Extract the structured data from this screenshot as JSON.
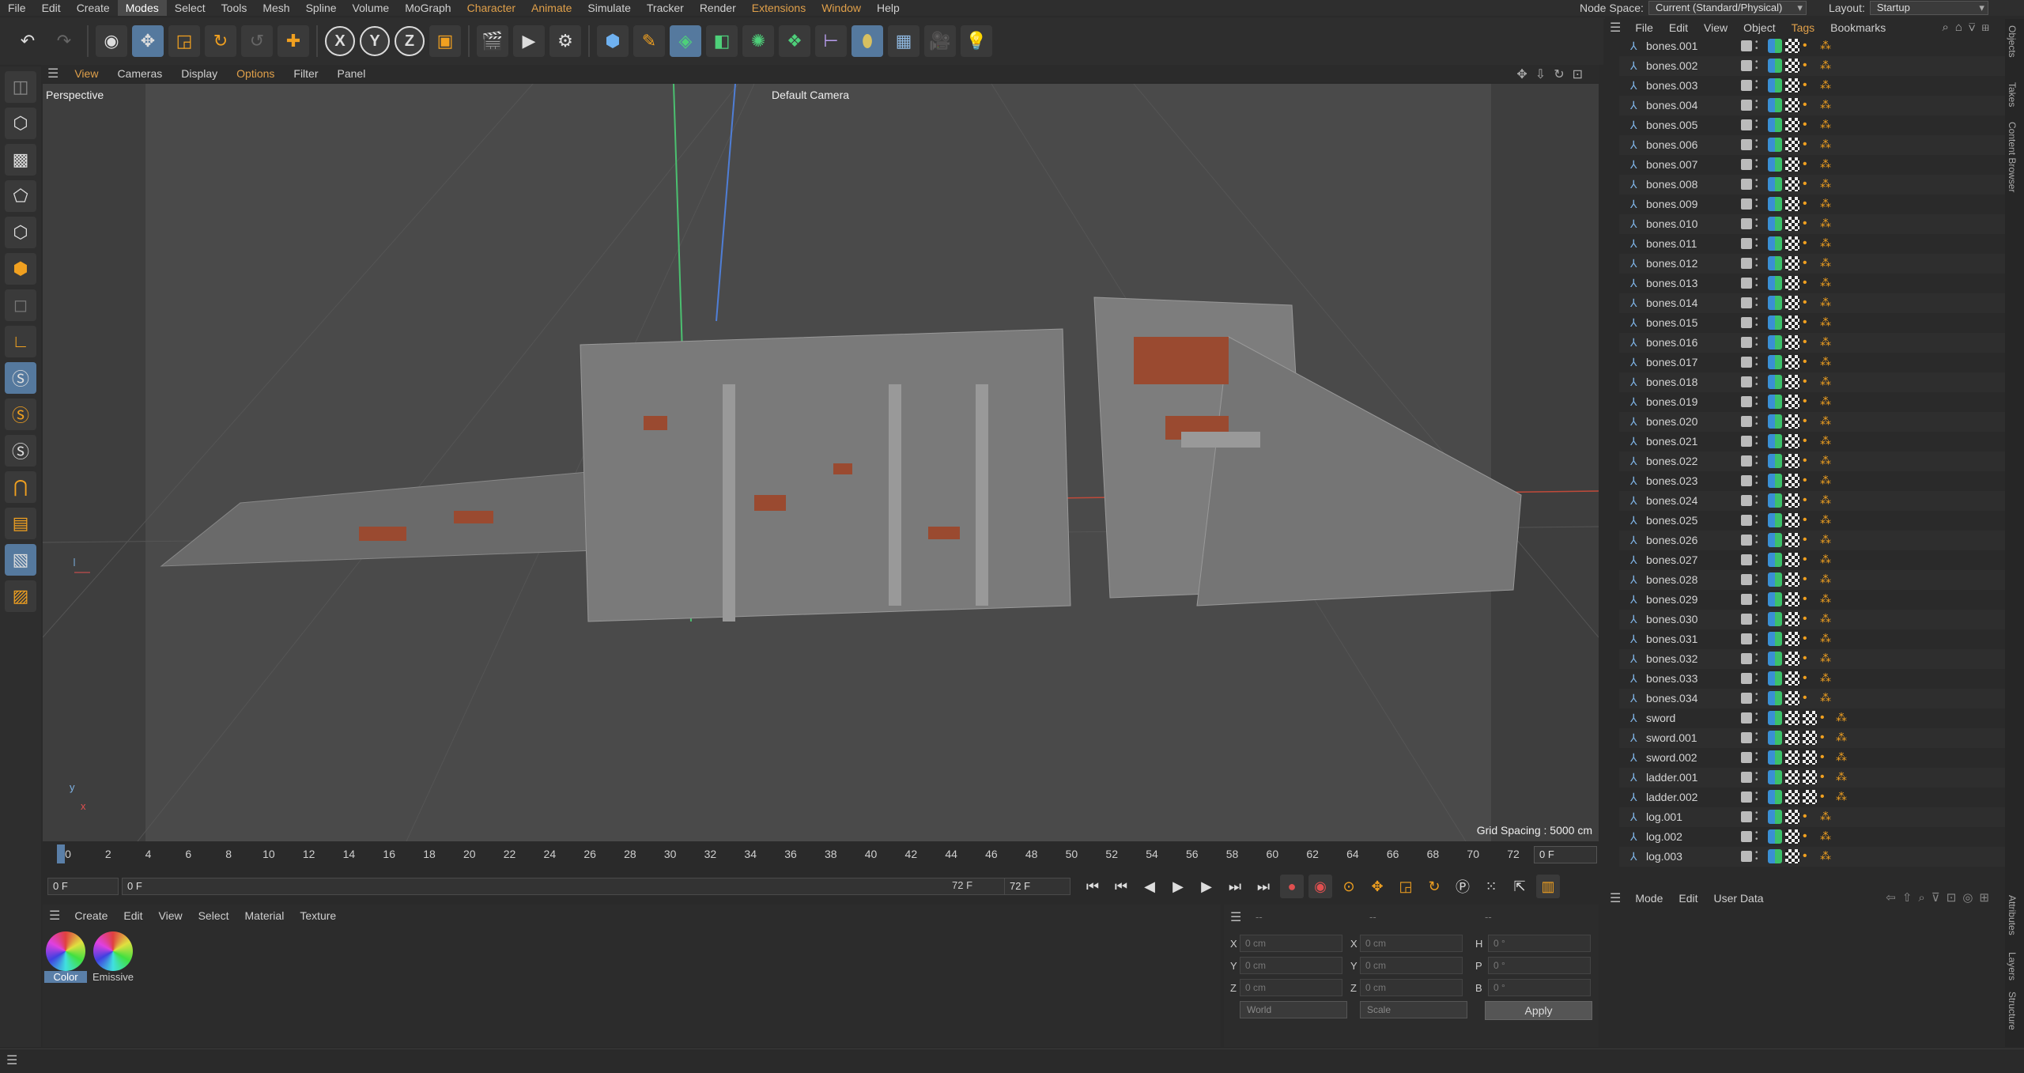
{
  "menubar": {
    "items": [
      "File",
      "Edit",
      "Create",
      "Modes",
      "Select",
      "Tools",
      "Mesh",
      "Spline",
      "Volume",
      "MoGraph",
      "Character",
      "Animate",
      "Simulate",
      "Tracker",
      "Render",
      "Extensions",
      "Window",
      "Help"
    ],
    "active": "Modes",
    "node_space_label": "Node Space:",
    "node_space_value": "Current (Standard/Physical)",
    "layout_label": "Layout:",
    "layout_value": "Startup"
  },
  "toolbar": {
    "icons": [
      "undo-icon",
      "redo-icon",
      "live-selection-icon",
      "move-icon",
      "scale-icon",
      "rotate-icon",
      "recent-tool-icon",
      "add-icon",
      "x-axis-icon",
      "y-axis-icon",
      "z-axis-icon",
      "coordinate-system-icon",
      "render-view-icon",
      "render-picture-viewer-icon",
      "render-settings-icon",
      "cube-icon",
      "pen-icon",
      "subdivision-icon",
      "extrude-icon",
      "cloner-icon",
      "array-icon",
      "deformer-icon",
      "field-icon",
      "floor-icon",
      "camera-icon",
      "light-icon"
    ],
    "xyz": [
      "X",
      "Y",
      "Z"
    ]
  },
  "left_tools": [
    "make-editable-icon",
    "model-mode-icon",
    "texture-mode-icon",
    "points-mode-icon",
    "edges-mode-icon",
    "polygons-mode-icon",
    "uv-mode-icon",
    "axis-icon",
    "snap-icon",
    "snap-settings-icon",
    "workplane-icon",
    "magnet-icon",
    "grid-icon",
    "lock-icon",
    "solo-icon"
  ],
  "viewport": {
    "menu": [
      "View",
      "Cameras",
      "Display",
      "Options",
      "Filter",
      "Panel"
    ],
    "label": "Perspective",
    "camera": "Default Camera",
    "grid_spacing": "Grid Spacing : 5000 cm",
    "axis_y": "y",
    "axis_x": "x"
  },
  "timeline": {
    "ticks": [
      "0",
      "2",
      "4",
      "6",
      "8",
      "10",
      "12",
      "14",
      "16",
      "18",
      "20",
      "22",
      "24",
      "26",
      "28",
      "30",
      "32",
      "34",
      "36",
      "38",
      "40",
      "42",
      "44",
      "46",
      "48",
      "50",
      "52",
      "54",
      "56",
      "58",
      "60",
      "62",
      "64",
      "66",
      "68",
      "70",
      "72"
    ],
    "current_frame": "0 F"
  },
  "transport": {
    "start": "0 F",
    "current": "0 F",
    "end_inner": "72 F",
    "end": "72 F"
  },
  "material_manager": {
    "menu": [
      "Create",
      "Edit",
      "View",
      "Select",
      "Material",
      "Texture"
    ],
    "materials": [
      {
        "name": "Color",
        "selected": true
      },
      {
        "name": "Emissive",
        "selected": false
      }
    ]
  },
  "coordinates": {
    "headers": [
      "--",
      "--",
      "--"
    ],
    "rows": [
      {
        "a": "X",
        "av": "0 cm",
        "b": "X",
        "bv": "0 cm",
        "c": "H",
        "cv": "0 °"
      },
      {
        "a": "Y",
        "av": "0 cm",
        "b": "Y",
        "bv": "0 cm",
        "c": "P",
        "cv": "0 °"
      },
      {
        "a": "Z",
        "av": "0 cm",
        "b": "Z",
        "bv": "0 cm",
        "c": "B",
        "cv": "0 °"
      }
    ],
    "space": "World",
    "mode": "Scale",
    "apply": "Apply"
  },
  "objects_panel": {
    "menu": [
      "File",
      "Edit",
      "View",
      "Object",
      "Tags",
      "Bookmarks"
    ],
    "objects": [
      "bones.001",
      "bones.002",
      "bones.003",
      "bones.004",
      "bones.005",
      "bones.006",
      "bones.007",
      "bones.008",
      "bones.009",
      "bones.010",
      "bones.011",
      "bones.012",
      "bones.013",
      "bones.014",
      "bones.015",
      "bones.016",
      "bones.017",
      "bones.018",
      "bones.019",
      "bones.020",
      "bones.021",
      "bones.022",
      "bones.023",
      "bones.024",
      "bones.025",
      "bones.026",
      "bones.027",
      "bones.028",
      "bones.029",
      "bones.030",
      "bones.031",
      "bones.032",
      "bones.033",
      "bones.034",
      "sword",
      "sword.001",
      "sword.002",
      "ladder.001",
      "ladder.002",
      "log.001",
      "log.002",
      "log.003"
    ]
  },
  "attributes_panel": {
    "menu": [
      "Mode",
      "Edit",
      "User Data"
    ]
  },
  "side_tabs": [
    "Objects",
    "Takes",
    "Content Browser",
    "Attributes",
    "Layers",
    "Structure"
  ],
  "colors": {
    "accent": "#55799e",
    "orange": "#e0a04a",
    "viewport_bg": "#4a4a4a"
  }
}
